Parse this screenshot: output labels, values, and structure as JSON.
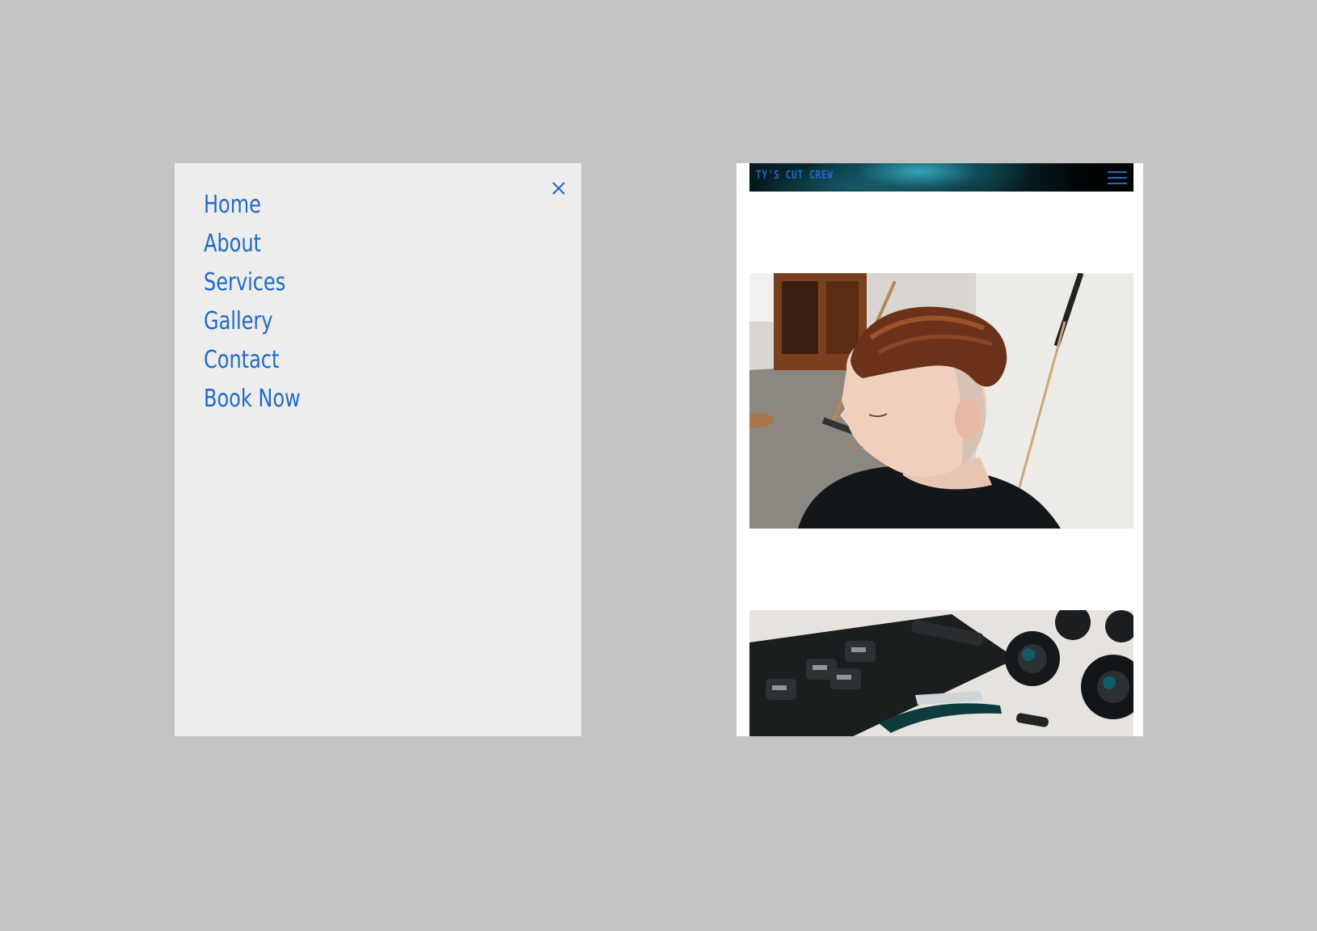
{
  "menu": {
    "close_icon": "close-icon",
    "items": [
      {
        "label": "Home"
      },
      {
        "label": "About"
      },
      {
        "label": "Services"
      },
      {
        "label": "Gallery"
      },
      {
        "label": "Contact"
      },
      {
        "label": "Book Now"
      }
    ]
  },
  "site": {
    "brand": "TY'S CUT CREW",
    "menu_icon": "hamburger-menu-icon",
    "images": [
      {
        "subject": "haircut-photo"
      },
      {
        "subject": "barber-tools-photo"
      }
    ]
  },
  "colors": {
    "canvas_background": "#c4c4c4",
    "menu_background": "#ededed",
    "accent": "#1f6ac6",
    "page_background": "#ffffff"
  }
}
